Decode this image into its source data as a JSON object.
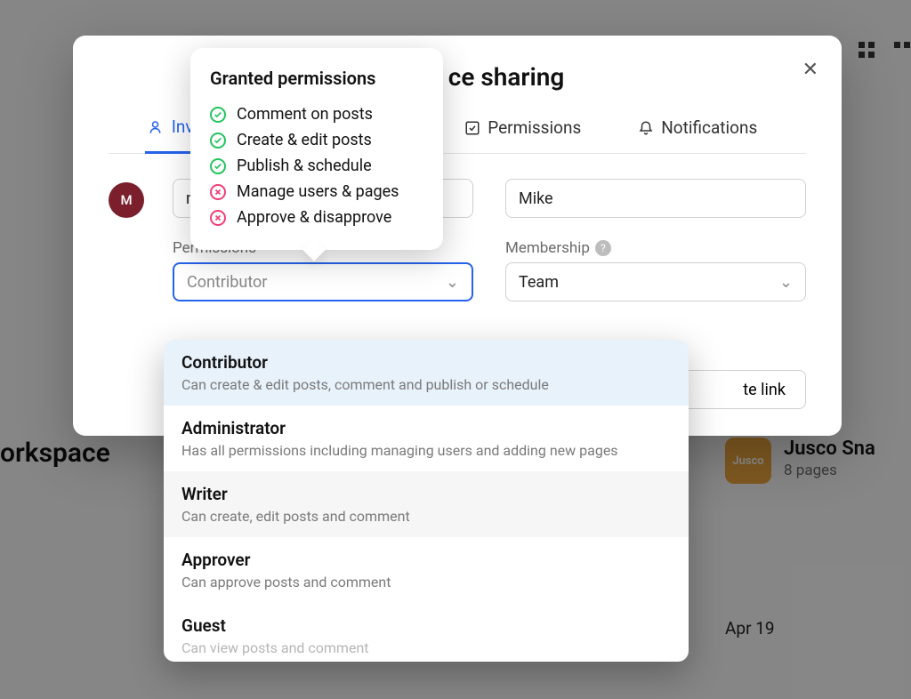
{
  "background": {
    "workspace_label": "orkspace",
    "card_title": "Jusco Sna",
    "card_subtitle": "8 pages",
    "card_badge": "Jusco",
    "date": "Apr 19"
  },
  "modal": {
    "title_partial": "ce sharing",
    "tabs": {
      "invite": "Invi",
      "permissions": "Permissions",
      "notifications": "Notifications"
    },
    "avatar_initial": "M",
    "email_value": "m",
    "name_value": "Mike",
    "permissions_label": "Permissions",
    "permissions_value": "Contributor",
    "membership_label": "Membership",
    "membership_value": "Team",
    "invite_button_partial": "te link"
  },
  "tooltip": {
    "title": "Granted permissions",
    "items": [
      {
        "label": "Comment on posts",
        "granted": true
      },
      {
        "label": "Create & edit posts",
        "granted": true
      },
      {
        "label": "Publish & schedule",
        "granted": true
      },
      {
        "label": "Manage users & pages",
        "granted": false
      },
      {
        "label": "Approve & disapprove",
        "granted": false
      }
    ]
  },
  "dropdown": {
    "options": [
      {
        "name": "Contributor",
        "desc": "Can create & edit posts, comment and publish or schedule",
        "selected": true
      },
      {
        "name": "Administrator",
        "desc": "Has all permissions including managing users and adding new pages",
        "selected": false
      },
      {
        "name": "Writer",
        "desc": "Can create, edit posts and comment",
        "selected": false
      },
      {
        "name": "Approver",
        "desc": "Can approve posts and comment",
        "selected": false
      },
      {
        "name": "Guest",
        "desc": "Can view posts and comment",
        "selected": false
      }
    ]
  }
}
